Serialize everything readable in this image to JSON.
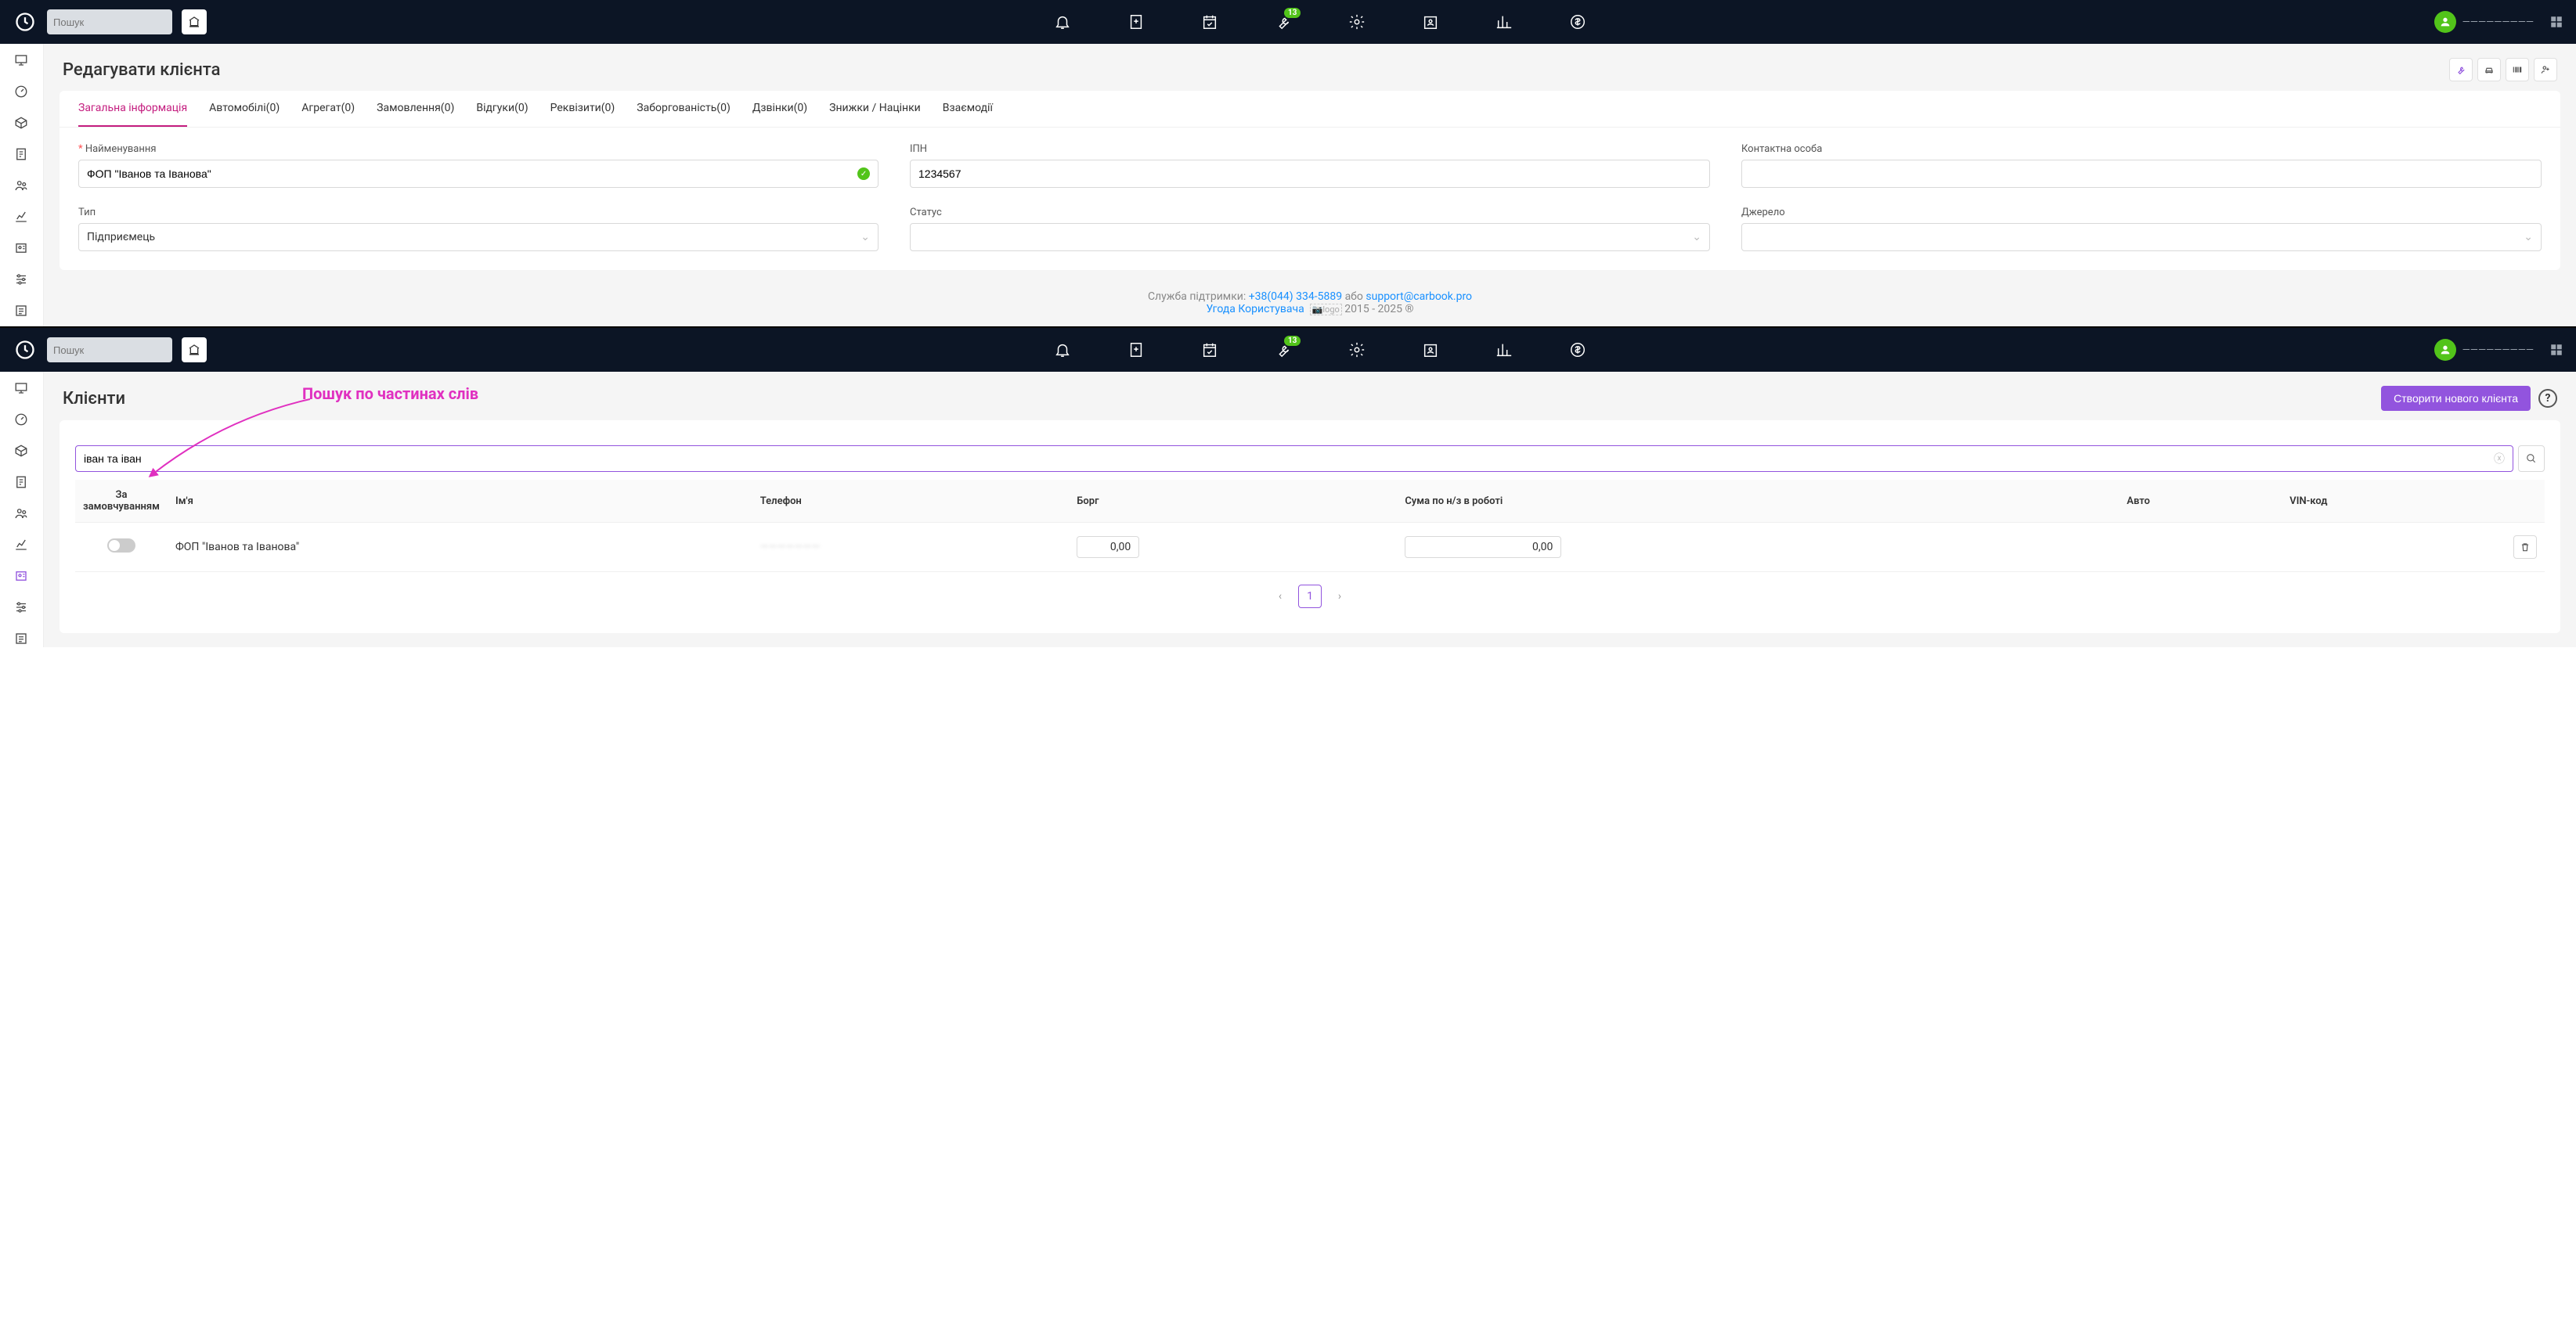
{
  "topbar": {
    "search_placeholder": "Пошук",
    "badge_count": "13",
    "user_name": "—————————"
  },
  "section1": {
    "page_title": "Редагувати клієнта",
    "tabs": [
      {
        "label": "Загальна інформація",
        "active": true
      },
      {
        "label": "Автомобілі(0)"
      },
      {
        "label": "Агрегат(0)"
      },
      {
        "label": "Замовлення(0)"
      },
      {
        "label": "Відгуки(0)"
      },
      {
        "label": "Реквізити(0)"
      },
      {
        "label": "Заборгованість(0)"
      },
      {
        "label": "Дзвінки(0)"
      },
      {
        "label": "Знижки / Націнки"
      },
      {
        "label": "Взаємодії"
      }
    ],
    "fields": {
      "name_label": "Найменування",
      "name_value": "ФОП \"Іванов та Іванова\"",
      "ipn_label": "ІПН",
      "ipn_value": "1234567",
      "contact_label": "Контактна особа",
      "contact_value": "",
      "type_label": "Тип",
      "type_value": "Підприємець",
      "status_label": "Статус",
      "status_value": "",
      "source_label": "Джерело",
      "source_value": ""
    },
    "footer": {
      "support_prefix": "Служба підтримки: ",
      "phone": "+38(044) 334-5889",
      "or": " або ",
      "email": "support@carbook.pro",
      "agreement": "Угода Користувача",
      "logo_alt": "logo",
      "years": " 2015 - 2025 ®"
    }
  },
  "section2": {
    "page_title": "Клієнти",
    "annotation": "Пошук по частинах слів",
    "create_button": "Створити нового клієнта",
    "search_value": "іван та іван",
    "table": {
      "headers": {
        "default": "За замовчуванням",
        "name": "Ім'я",
        "phone": "Телефон",
        "debt": "Борг",
        "sum": "Сума по н/з в роботі",
        "auto": "Авто",
        "vin": "VIN-код"
      },
      "row": {
        "name": "ФОП \"Іванов та Іванова\"",
        "phone": "———————",
        "debt": "0,00",
        "sum": "0,00"
      }
    },
    "pagination": {
      "current": "1"
    }
  },
  "icons": {
    "logo": "logo-icon",
    "search": "search-icon",
    "bank": "bank-icon",
    "bell": "bell-icon",
    "new_doc": "new-document-icon",
    "calendar_check": "calendar-check-icon",
    "wrench": "wrench-icon",
    "gear": "gear-icon",
    "id_card": "id-card-icon",
    "chart": "bar-chart-icon",
    "dollar": "dollar-icon",
    "user": "user-icon",
    "apps": "apps-icon"
  }
}
